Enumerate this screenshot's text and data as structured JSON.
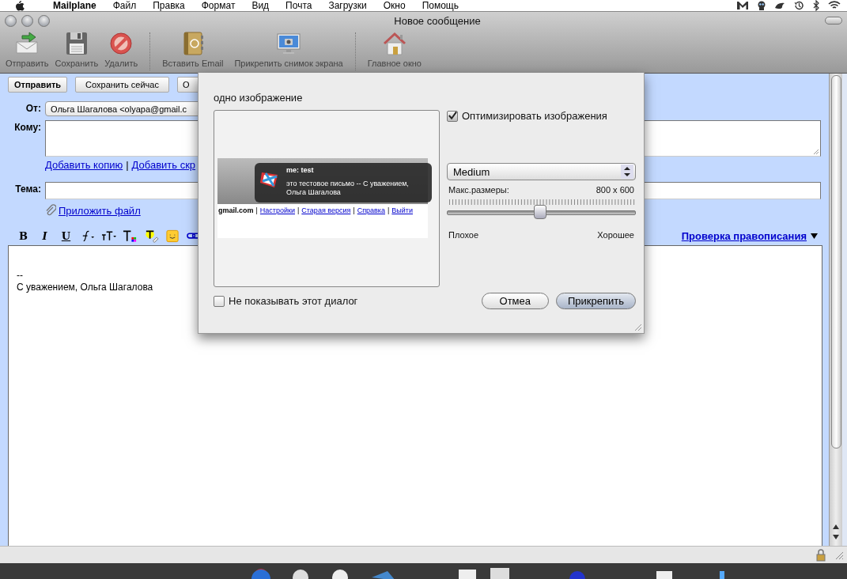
{
  "menu_bar": {
    "app": "Mailplane",
    "items": [
      "Файл",
      "Правка",
      "Формат",
      "Вид",
      "Почта",
      "Загрузки",
      "Окно",
      "Помощь"
    ]
  },
  "window": {
    "title": "Новое сообщение"
  },
  "toolbar": [
    {
      "label": "Отправить",
      "separator_before": false
    },
    {
      "label": "Сохранить",
      "separator_before": false
    },
    {
      "label": "Удалить",
      "separator_before": false
    },
    {
      "label": "Вставить Email",
      "separator_before": true
    },
    {
      "label": "Прикрепить снимок экрана",
      "separator_before": false
    },
    {
      "label": "Главное окно",
      "separator_before": true
    }
  ],
  "compose": {
    "buttons": [
      {
        "label": "Отправить",
        "bold": true
      },
      {
        "label": "Сохранить сейчас",
        "bold": false
      },
      {
        "label": "О",
        "bold": false
      }
    ],
    "from_label": "От:",
    "from_value": "Ольга Шагалова <olyapa@gmail.c",
    "to_label": "Кому:",
    "cc_links": {
      "items": [
        "Добавить копию",
        "Добавить скр"
      ],
      "separator": "|"
    },
    "subject_label": "Тема:",
    "attach_link": "Приложить файл",
    "format_buttons": [
      {
        "kind": "text",
        "label": "B"
      },
      {
        "kind": "text",
        "label": "I"
      },
      {
        "kind": "text",
        "label": "U"
      },
      {
        "kind": "icon"
      },
      {
        "kind": "icon"
      },
      {
        "kind": "icon"
      },
      {
        "kind": "icon"
      },
      {
        "kind": "icon"
      },
      {
        "kind": "icon"
      }
    ],
    "spellcheck": "Проверка правописания",
    "body_lines": [
      "--",
      "С уважением, Ольга Шагалова"
    ]
  },
  "dialog": {
    "title": "одно изображение",
    "preview": {
      "sender": "me: test",
      "message": "это тестовое письмо -- С уважением, Ольга Шагалова",
      "links": [
        {
          "kind": "bold",
          "text": "gmail.com"
        },
        {
          "kind": "link",
          "text": "Настройки"
        },
        {
          "kind": "link",
          "text": "Старая версия"
        },
        {
          "kind": "link",
          "text": "Справка"
        },
        {
          "kind": "link",
          "text": "Выйти"
        }
      ],
      "separator": "|"
    },
    "optimize": {
      "label": "Оптимизировать изображения",
      "checked": true
    },
    "quality": "Medium",
    "max_size_label": "Макс.размеры:",
    "max_size_value": "800 x 600",
    "slider": {
      "level": 0.49
    },
    "min_label": "Плохое",
    "max_label": "Хорошее",
    "dont_show": {
      "label": "Не показывать этот диалог",
      "checked": false
    },
    "buttons": [
      {
        "label": "Отмеа",
        "default": false
      },
      {
        "label": "Прикрепить",
        "default": true
      }
    ]
  }
}
